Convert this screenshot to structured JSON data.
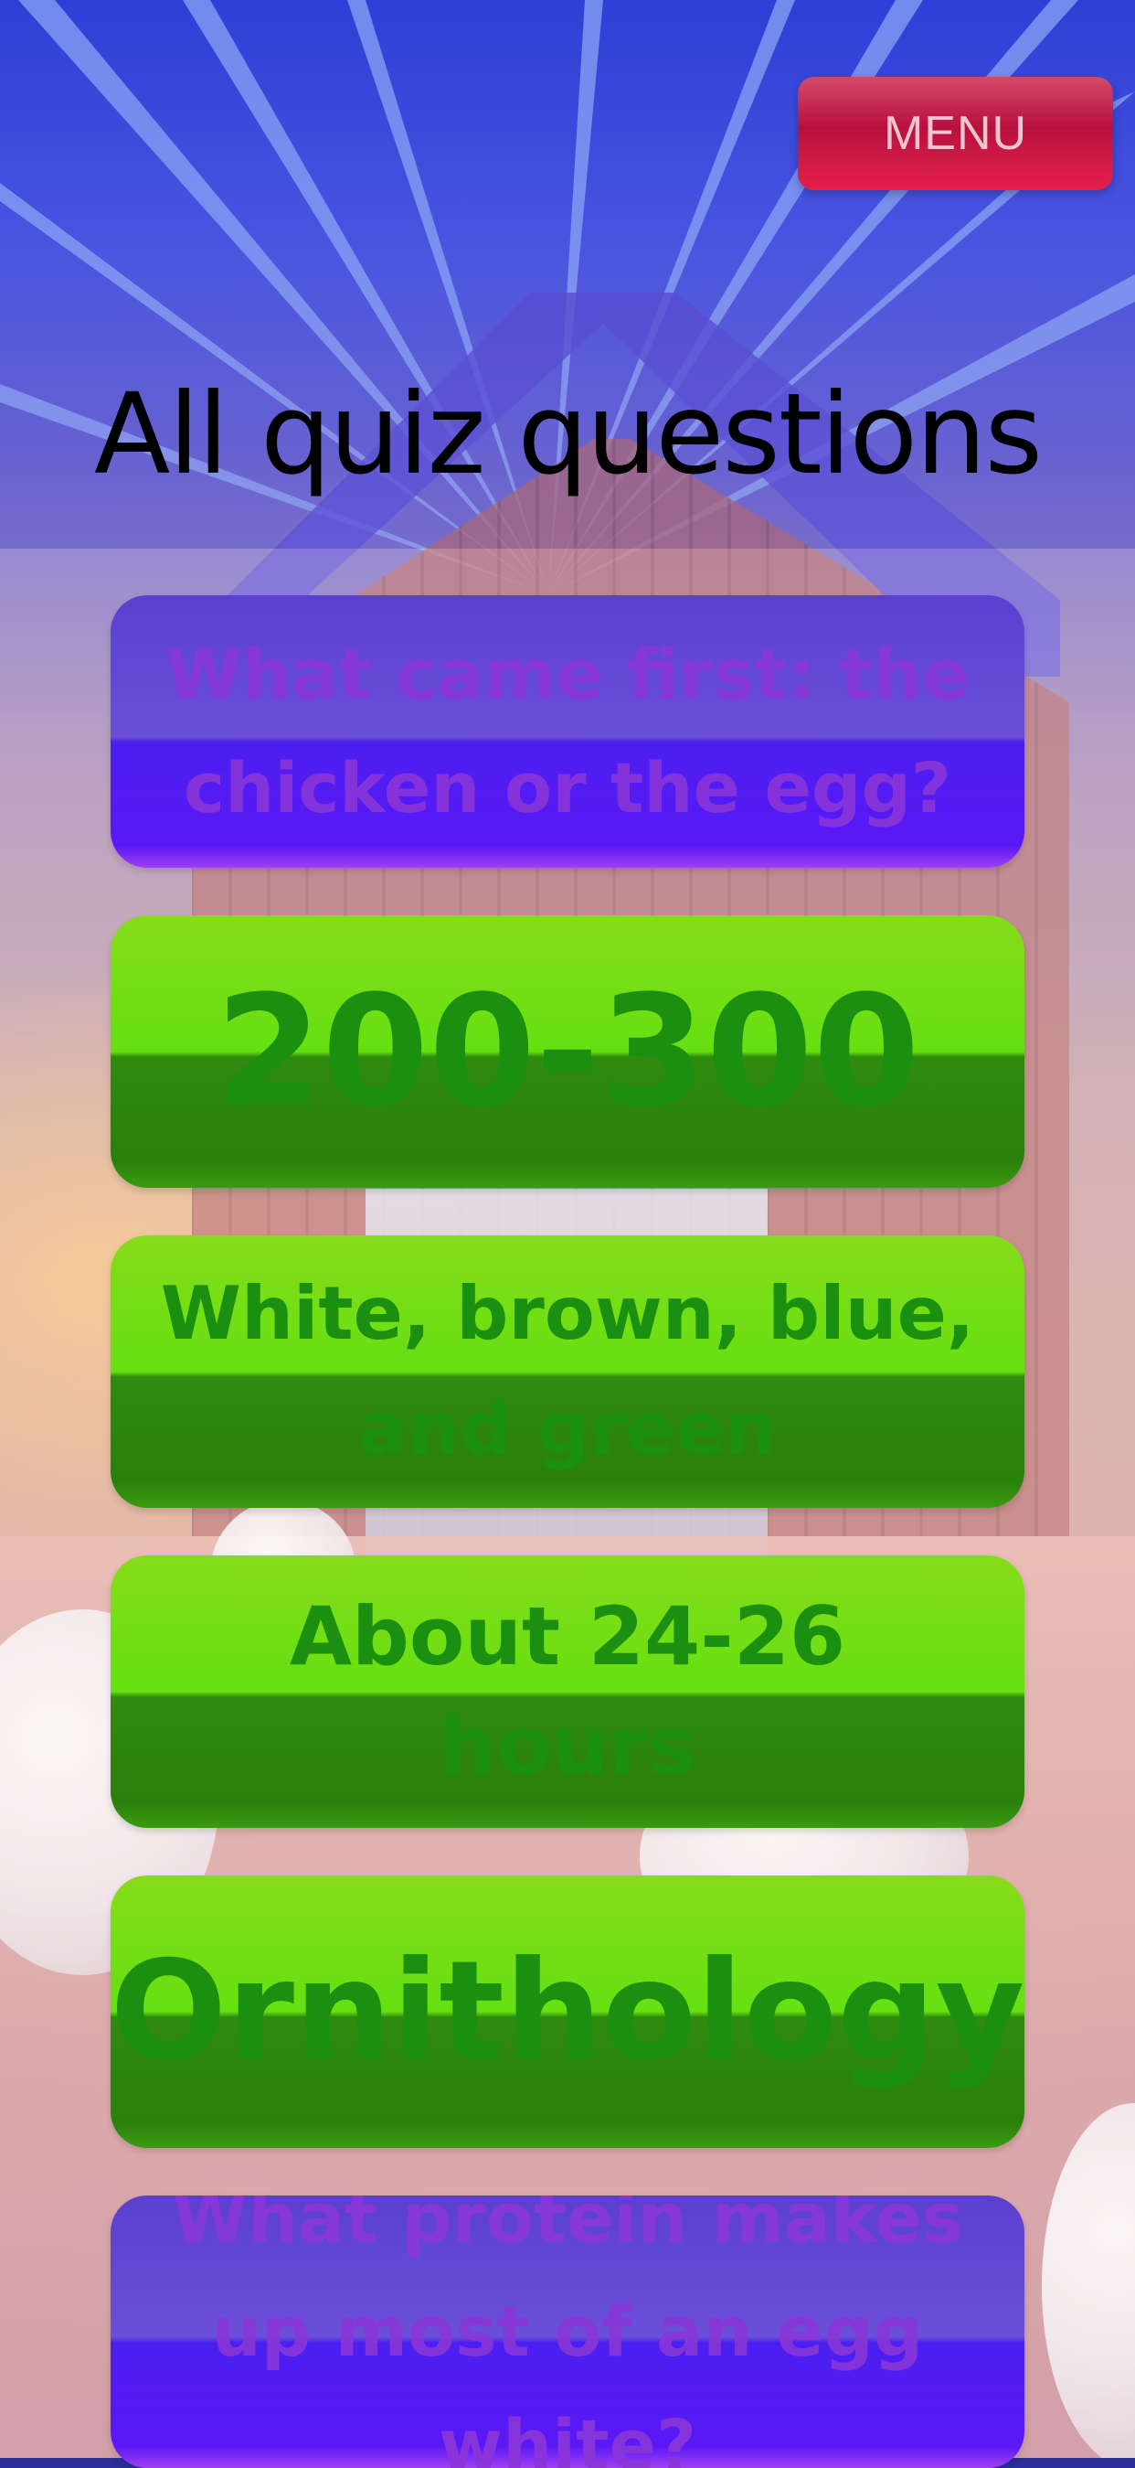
{
  "header": {
    "menu_label": "MENU",
    "title": "All quiz questions"
  },
  "cards": [
    {
      "kind": "question",
      "text": "What came first: the chicken or the egg?"
    },
    {
      "kind": "answer",
      "text": "200-300"
    },
    {
      "kind": "answer",
      "text": "White, brown, blue, and green"
    },
    {
      "kind": "answer",
      "text": "About 24-26 hours"
    },
    {
      "kind": "answer",
      "text": "Ornithology"
    },
    {
      "kind": "question",
      "text": "What protein makes up most of an egg white?"
    }
  ],
  "colors": {
    "menu_red": "#cf1b45",
    "question_purple": "#5a18f5",
    "answer_green": "#66e012",
    "answer_text_green": "#1a8f10",
    "question_text_purple": "#8a36d8"
  }
}
